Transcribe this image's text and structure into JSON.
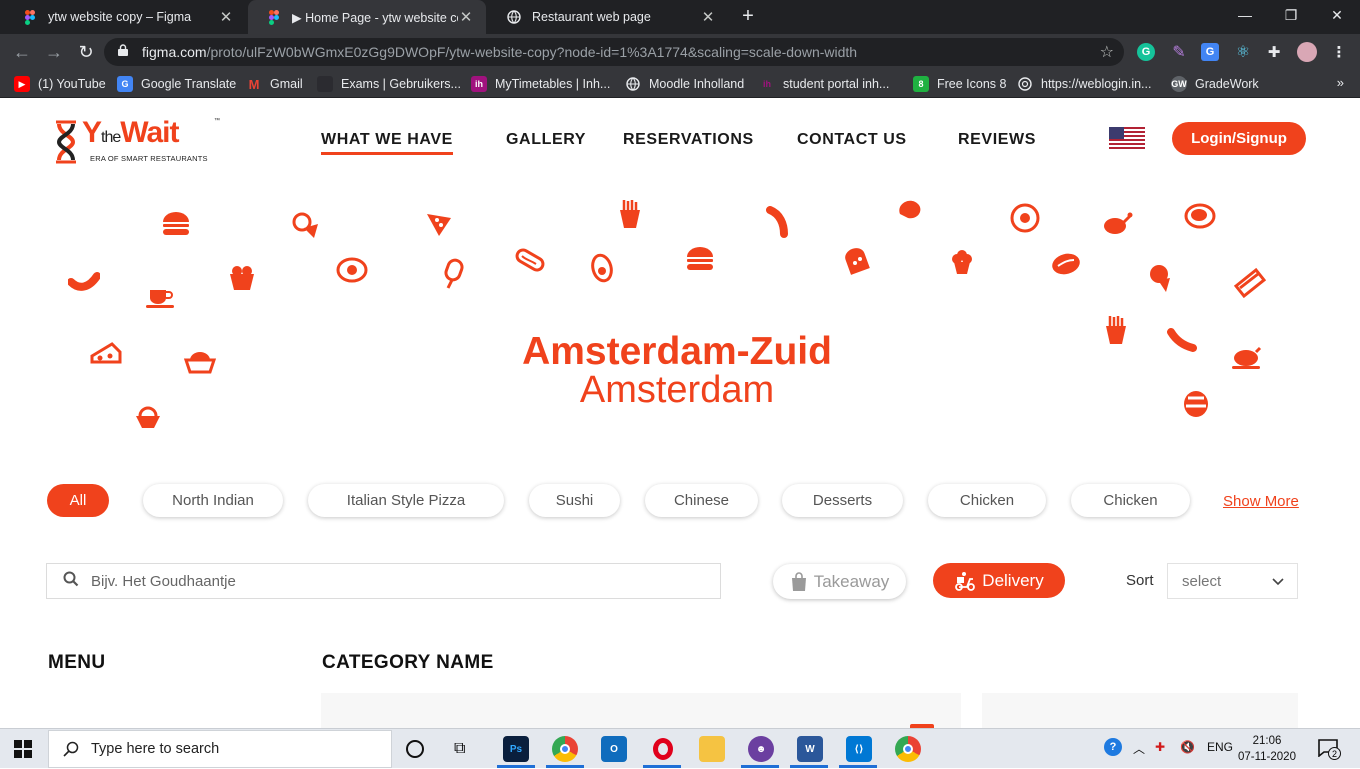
{
  "browser": {
    "tabs": [
      {
        "title": "ytw website copy – Figma",
        "icon": "figma-icon"
      },
      {
        "title": "▶ Home Page - ytw website copy",
        "icon": "figma-icon"
      },
      {
        "title": "Restaurant web page",
        "icon": "globe-icon"
      }
    ],
    "url_host": "figma.com",
    "url_rest": "/proto/ulFzW0bWGmxE0zGg9DWOpF/ytw-website-copy?node-id=1%3A1774&scaling=scale-down-width",
    "bookmarks": [
      "(1) YouTube",
      "Google Translate",
      "Gmail",
      "Exams | Gebruikers...",
      "MyTimetables | Inh...",
      "Moodle Inholland",
      "student portal inh...",
      "Free Icons 8",
      "https://weblogin.in...",
      "GradeWork"
    ],
    "bookmarks_more": "»"
  },
  "site": {
    "brand": {
      "main": "Y",
      "small": "the",
      "wait": "Wait",
      "tm": "™",
      "tagline": "ERA OF SMART RESTAURANTS"
    },
    "nav": [
      "WHAT WE HAVE",
      "GALLERY",
      "RESERVATIONS",
      "CONTACT US",
      "REVIEWS"
    ],
    "login": "Login/Signup",
    "hero_title": "Amsterdam-Zuid",
    "hero_subtitle": "Amsterdam",
    "categories": [
      "All",
      "North Indian",
      "Italian Style Pizza",
      "Sushi",
      "Chinese",
      "Desserts",
      "Chicken",
      "Chicken"
    ],
    "show_more": "Show More",
    "search_placeholder": "Bijv. Het Goudhaantje",
    "takeaway": "Takeaway",
    "delivery": "Delivery",
    "sort_label": "Sort",
    "sort_value": "select",
    "menu_heading": "MENU",
    "category_heading": "CATEGORY NAME",
    "accent": "#f0421c"
  },
  "taskbar": {
    "search_placeholder": "Type here to search",
    "language": "ENG",
    "time": "21:06",
    "date": "07-11-2020",
    "notifications": "2"
  }
}
